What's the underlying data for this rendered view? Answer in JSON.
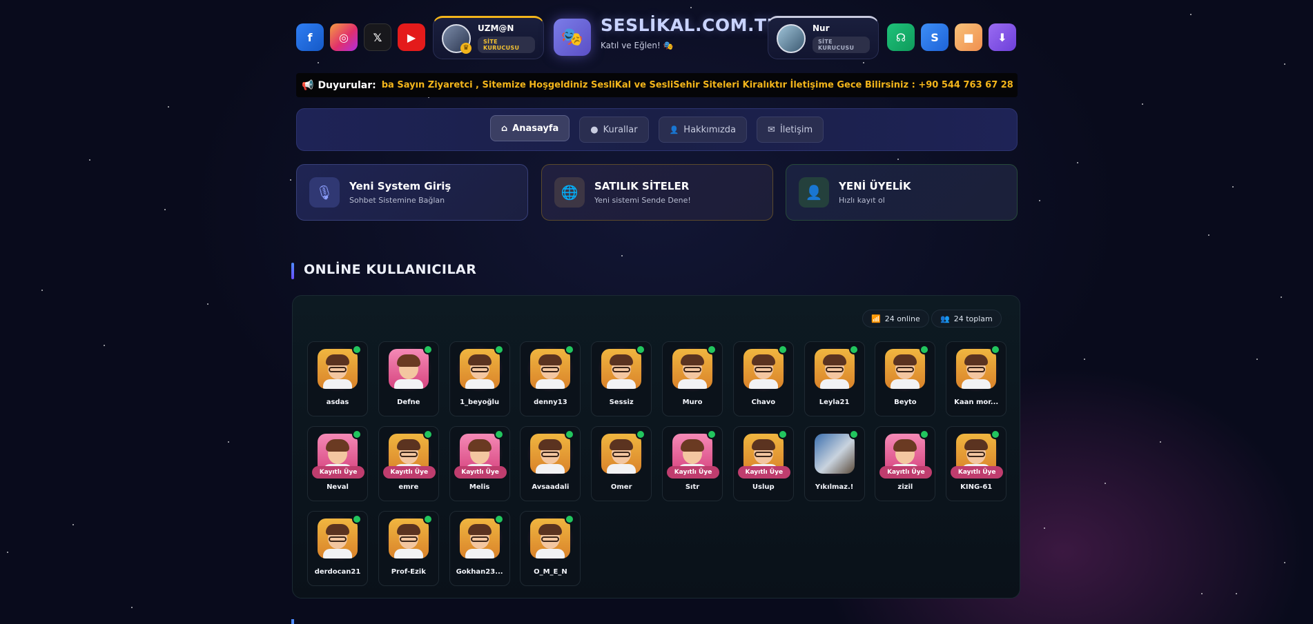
{
  "header": {
    "left_social": [
      {
        "icon": "facebook-icon",
        "glyph": "f"
      },
      {
        "icon": "instagram-icon",
        "glyph": "◎"
      },
      {
        "icon": "x-icon",
        "glyph": "𝕏"
      },
      {
        "icon": "youtube-icon",
        "glyph": "▶"
      }
    ],
    "admins": [
      {
        "name": "UZM@N",
        "badge": "SİTE KURUCUSU"
      },
      {
        "name": "Nur",
        "badge": "SİTE KURUCUSU"
      }
    ],
    "logo_glyph": "🎭",
    "site_title": "SESLİKAL.COM.TR",
    "site_subtitle": "Katıl ve Eğlen! 🎭",
    "right_social": [
      {
        "icon": "headset-icon",
        "glyph": "☊"
      },
      {
        "icon": "skype-icon",
        "glyph": "S"
      },
      {
        "icon": "video-icon",
        "glyph": "■"
      },
      {
        "icon": "download-icon",
        "glyph": "⬇"
      }
    ]
  },
  "announcement": {
    "icon": "megaphone-icon",
    "label": "Duyurular:",
    "text": "ba Sayın Ziyaretci , Sitemize Hoşgeldiniz SesliKal ve SesliSehir Siteleri Kiralıktır İletişime Gece Bilirsiniz : +90 544 763 67 28"
  },
  "nav": {
    "tabs": [
      {
        "label": "Anasayfa",
        "icon": "home-icon",
        "glyph": "⌂",
        "active": true
      },
      {
        "label": "Kurallar",
        "icon": "info-icon",
        "glyph": "●",
        "active": false
      },
      {
        "label": "Hakkımızda",
        "icon": "user-icon",
        "glyph": "👤",
        "active": false
      },
      {
        "label": "İletişim",
        "icon": "mail-icon",
        "glyph": "✉",
        "active": false
      }
    ]
  },
  "cards": [
    {
      "title": "Yeni System Giriş",
      "subtitle": "Sohbet Sistemine Bağlan",
      "icon": "microphone-icon",
      "glyph": "🎙"
    },
    {
      "title": "SATILIK SİTELER",
      "subtitle": "Yeni sistemi Sende Dene!",
      "icon": "globe-icon",
      "glyph": "🌐"
    },
    {
      "title": "YENİ ÜYELİK",
      "subtitle": "Hızlı kayıt ol",
      "icon": "user-plus-icon",
      "glyph": "👤"
    }
  ],
  "online": {
    "section_title": "ONLİNE KULLANICILAR",
    "online_count": "24 online",
    "total_count": "24 toplam",
    "registered_label": "Kayıtlı Üye",
    "users": [
      {
        "name": "asdas",
        "avatar": "boy",
        "registered": false
      },
      {
        "name": "Defne",
        "avatar": "girl",
        "registered": false
      },
      {
        "name": "1_beyoğlu",
        "avatar": "boy",
        "registered": false
      },
      {
        "name": "denny13",
        "avatar": "boy",
        "registered": false
      },
      {
        "name": "Sessiz",
        "avatar": "boy",
        "registered": false
      },
      {
        "name": "Muro",
        "avatar": "boy",
        "registered": false
      },
      {
        "name": "Chavo",
        "avatar": "boy",
        "registered": false
      },
      {
        "name": "Leyla21",
        "avatar": "boy",
        "registered": false
      },
      {
        "name": "Beyto",
        "avatar": "boy",
        "registered": false
      },
      {
        "name": "Kaan mor...",
        "avatar": "boy",
        "registered": false
      },
      {
        "name": "Neval",
        "avatar": "girl",
        "registered": true
      },
      {
        "name": "emre",
        "avatar": "boy",
        "registered": true
      },
      {
        "name": "Melis",
        "avatar": "girl",
        "registered": true
      },
      {
        "name": "Avsaadali",
        "avatar": "boy",
        "registered": false
      },
      {
        "name": "Ömer",
        "avatar": "boy",
        "registered": false
      },
      {
        "name": "Sıtr",
        "avatar": "girl",
        "registered": true
      },
      {
        "name": "Uslup",
        "avatar": "boy",
        "registered": true
      },
      {
        "name": "Yıkılmaz.!",
        "avatar": "photo",
        "registered": false
      },
      {
        "name": "zizil",
        "avatar": "girl",
        "registered": true
      },
      {
        "name": "KING-61",
        "avatar": "boy",
        "registered": true
      },
      {
        "name": "derdocan21",
        "avatar": "boy",
        "registered": false
      },
      {
        "name": "Prof-Ezik",
        "avatar": "boy",
        "registered": false
      },
      {
        "name": "Gokhan23...",
        "avatar": "boy",
        "registered": false
      },
      {
        "name": "O_M_E_N",
        "avatar": "boy",
        "registered": false
      }
    ]
  },
  "colors": {
    "accent": "#f3b51b",
    "online": "#22c55e",
    "badge": "#bf3d6e"
  }
}
